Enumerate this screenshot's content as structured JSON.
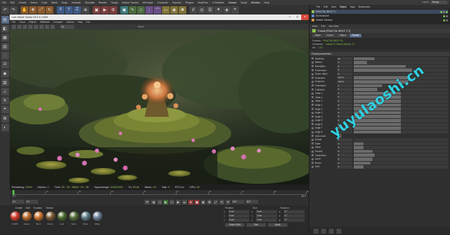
{
  "menubar": {
    "items": [
      "File",
      "Edit",
      "Create",
      "Select",
      "Tools",
      "Mesh",
      "Snap",
      "Animate",
      "Simulate",
      "Render",
      "Sculpt",
      "Motion Tracker",
      "MoGraph",
      "Character",
      "Pipeline",
      "Plugins",
      "RealFlow",
      "X-Particles",
      "Octane",
      "Script",
      "Window",
      "Help"
    ],
    "layout_label": "Layout:",
    "layout_value": "Startup"
  },
  "viewport": {
    "window_title": "Live Viewer Studio V3.0.3 | 32bit",
    "menu": [
      "File",
      "Cloud",
      "Objects",
      "Materials",
      "Compare",
      "Options",
      "Help",
      "GUI"
    ],
    "mode": "PMDT",
    "preset": "DL",
    "status": {
      "rendering_label": "Rendering:",
      "rendering": "100%",
      "ms_label": "Ms/sec:",
      "ms": "0",
      "time_label": "Time:",
      "time": "00 : 00 : 38/00 : 00 : 38",
      "spp_label": "Spp/maxspp:",
      "spp": "1000/1000",
      "tri_label": "Tri:",
      "tri": "0/14k",
      "mesh_label": "Mesh:",
      "mesh": "1/2",
      "hair_label": "Hair:",
      "hair": "0",
      "rtx_label": "RTX:on",
      "gpu_label": "GPU:",
      "gpu": "42"
    }
  },
  "timeline": {
    "ticks": [
      "0",
      "10",
      "20",
      "30",
      "40",
      "50",
      "60",
      "70",
      "80",
      "90"
    ],
    "start": "0 F",
    "end": "90 F"
  },
  "transport": {
    "frame_start": "0 F",
    "frame_cur": "0 F",
    "frame_end": "90 F",
    "frame_max": "90 F"
  },
  "materials": {
    "menu": [
      "Create",
      "Edit",
      "Function",
      "Texture"
    ],
    "items": [
      {
        "name": "OctDiff",
        "color": "#d33c2a"
      },
      {
        "name": "Glossy",
        "color": "#b86a2c"
      },
      {
        "name": "Mat.1",
        "color": "#c9722e"
      },
      {
        "name": "Flower",
        "color": "#7a5a35"
      },
      {
        "name": "Leaf",
        "color": "#4a6b2e"
      },
      {
        "name": "Moss",
        "color": "#566f3a"
      },
      {
        "name": "Stone",
        "color": "#5c7b86"
      },
      {
        "name": "Water",
        "color": "#6a7f96"
      }
    ]
  },
  "coords": {
    "headers": [
      "Position",
      "Size",
      "Rotation"
    ],
    "rows": [
      {
        "l1": "X",
        "v1": "0 cm",
        "l2": "X",
        "v2": "0 cm",
        "l3": "H",
        "v3": "0 °"
      },
      {
        "l1": "Y",
        "v1": "0 cm",
        "l2": "Y",
        "v2": "0 cm",
        "l3": "P",
        "v3": "0 °"
      },
      {
        "l1": "Z",
        "v1": "0 cm",
        "l2": "Z",
        "v2": "0 cm",
        "l3": "B",
        "v3": "0 °"
      }
    ],
    "mode": "Object (Rel)",
    "size_mode": "Size",
    "apply": "Apply"
  },
  "objects": {
    "menu": [
      "File",
      "Edit",
      "View",
      "Object",
      "Tags",
      "Bookmarks"
    ],
    "list": [
      "FRACTAL BROT 1\"",
      "Environment",
      "Octane Camera"
    ]
  },
  "attributes": {
    "menu": [
      "Mode",
      "Edit",
      "User Data"
    ],
    "header": "Fractal [FRACTAL BROT 1\"1]",
    "tabs": [
      "Basic",
      "Coord.",
      "Object",
      "Fractal"
    ],
    "info": [
      {
        "k": "Formula:",
        "v": "FRACTAL BROT 3D"
      },
      {
        "k": "Checksum:",
        "v": "Loaded: 6 Fractal Objects: 12"
      },
      {
        "k": "Ver:",
        "v": "2.33"
      }
    ],
    "group_title": "Fractal parameters",
    "params": [
      {
        "label": "Iterations",
        "value": "20",
        "fill": 0.22
      },
      {
        "label": "Bailout",
        "value": "2",
        "fill": 0.14
      },
      {
        "label": "Mhradjkha",
        "value": "0",
        "fill": 0.55
      },
      {
        "label": "Powervalue",
        "value": "8",
        "fill": 0.62
      },
      {
        "label": "Power offset",
        "value": "0",
        "fill": 0.0
      },
      {
        "label": "Scale/size",
        "value": "120 %",
        "fill": 0.58
      },
      {
        "label": "Scale/z/w",
        "value": "120 %",
        "fill": 0.58
      },
      {
        "label": "FoldSwitch",
        "value": "1",
        "fill": 0.3
      },
      {
        "label": "FoldSeed",
        "value": "0",
        "fill": 0.25
      },
      {
        "label": "Juliac x",
        "value": "0",
        "fill": 0.5
      },
      {
        "label": "Juliac y",
        "value": "0",
        "fill": 0.5
      },
      {
        "label": "Juliac z",
        "value": "0",
        "fill": 0.5
      },
      {
        "label": "Angle 1",
        "value": "0",
        "fill": 0.5
      },
      {
        "label": "Angle 2",
        "value": "0",
        "fill": 0.5
      },
      {
        "label": "Angle 3",
        "value": "0",
        "fill": 0.5
      },
      {
        "label": "Angle 4",
        "value": "0",
        "fill": 0.5
      },
      {
        "label": "Angle 5",
        "value": "0",
        "fill": 0.5
      },
      {
        "label": "Angle 6",
        "value": "0",
        "fill": 0.5
      },
      {
        "label": "Angle 7",
        "value": "0",
        "fill": 0.5
      },
      {
        "label": "Angle 8",
        "value": "0",
        "fill": 0.5
      },
      {
        "label": "Julia mode",
        "value": "",
        "fill": null
      },
      {
        "label": "Rotate",
        "value": "0",
        "fill": 0.0
      },
      {
        "label": "Scale",
        "value": "0",
        "fill": 0.1
      },
      {
        "label": "Offset",
        "value": "0",
        "fill": 0.1
      },
      {
        "label": "Smooth",
        "value": "0",
        "fill": 0.2
      },
      {
        "label": "Twist/shear",
        "value": "0",
        "fill": 0.22
      },
      {
        "label": "Invert",
        "value": "0",
        "fill": 0.2
      },
      {
        "label": "Bloom",
        "value": "0",
        "fill": 0.18
      },
      {
        "label": "Gain",
        "value": "0",
        "fill": 0.1
      }
    ]
  },
  "watermark": "yuyulaoshi.cn"
}
